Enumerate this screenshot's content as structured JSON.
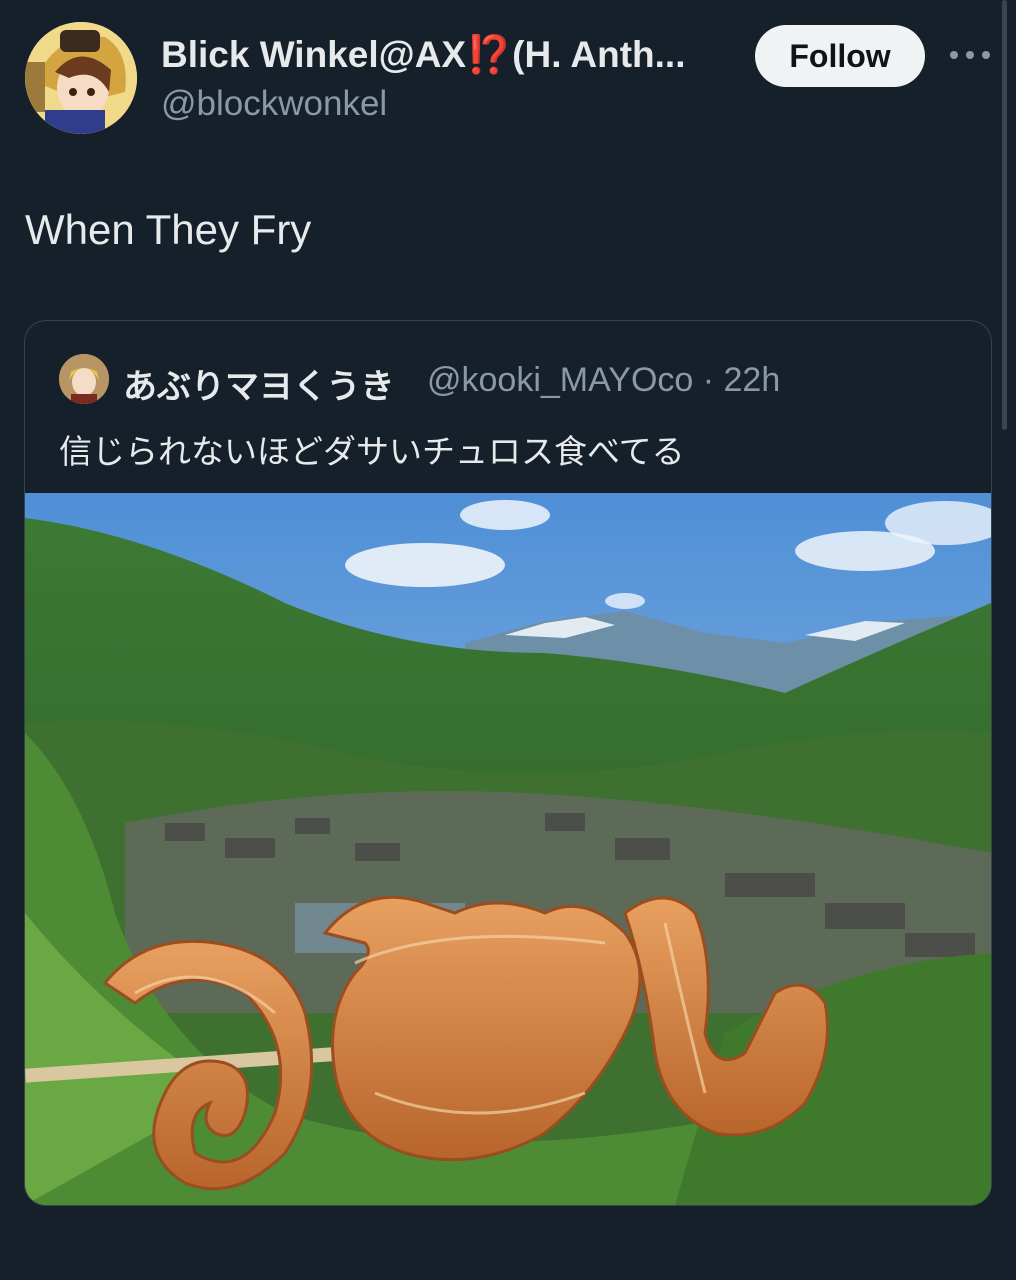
{
  "author": {
    "display_name": "Blick Winkel@AX⁉️(H. Anth...",
    "handle": "@blockwonkel",
    "avatar_icon": "anime-avatar-icon"
  },
  "actions": {
    "follow_label": "Follow",
    "more_icon": "more-options-icon"
  },
  "tweet": {
    "text": "When They Fry"
  },
  "quoted_tweet": {
    "display_name": "あぶりマヨくうき",
    "handle_time": "@kooki_MAYOco · 22h",
    "text": "信じられないほどダサいチュロス食べてる",
    "image_description_icon": "churros-photo"
  },
  "colors": {
    "background": "#15202b",
    "text_primary": "#e7e9ea",
    "text_secondary": "#8b98a5",
    "border": "#38444d",
    "follow_bg": "#eff3f4"
  }
}
